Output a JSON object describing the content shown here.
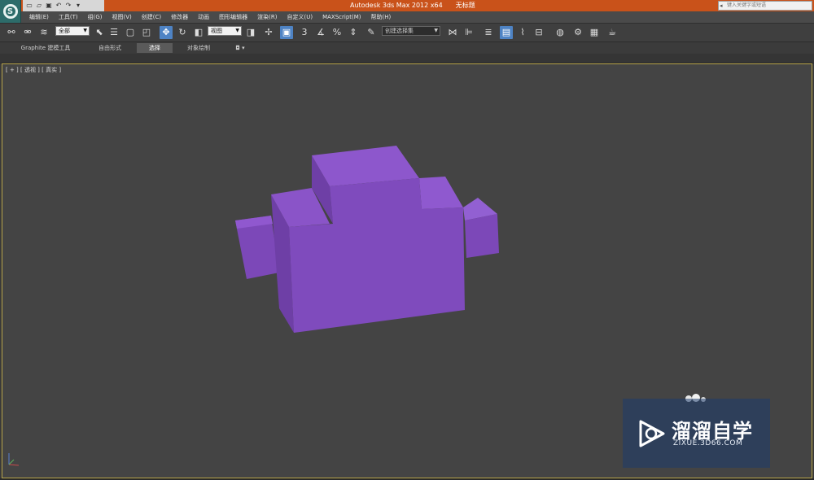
{
  "title_bar": {
    "app_name": "Autodesk 3ds Max  2012 x64",
    "document": "无标题",
    "search_placeholder": "键入关键字或短语",
    "logo_letter": "S"
  },
  "quick_access": [
    "new-icon",
    "open-icon",
    "save-icon",
    "undo-icon",
    "redo-icon",
    "dropdown-icon"
  ],
  "menu": [
    "编辑(E)",
    "工具(T)",
    "组(G)",
    "视图(V)",
    "创建(C)",
    "修改器",
    "动画",
    "图形编辑器",
    "渲染(R)",
    "自定义(U)",
    "MAXScript(M)",
    "帮助(H)"
  ],
  "toolbar": {
    "selection_filter": "全部",
    "reference_coord": "视图",
    "named_selection": "创建选择集"
  },
  "ribbon_tabs": [
    {
      "label": "Graphite 建模工具",
      "active": false
    },
    {
      "label": "自由形式",
      "active": false
    },
    {
      "label": "选择",
      "active": true
    },
    {
      "label": "对象绘制",
      "active": false
    }
  ],
  "viewport": {
    "label": "[ + ] [ 透视 ] [ 真实 ]",
    "object_color": "#8250c0"
  },
  "watermark": {
    "title": "溜溜自学",
    "url": "ZIXUE.3D66.COM"
  }
}
